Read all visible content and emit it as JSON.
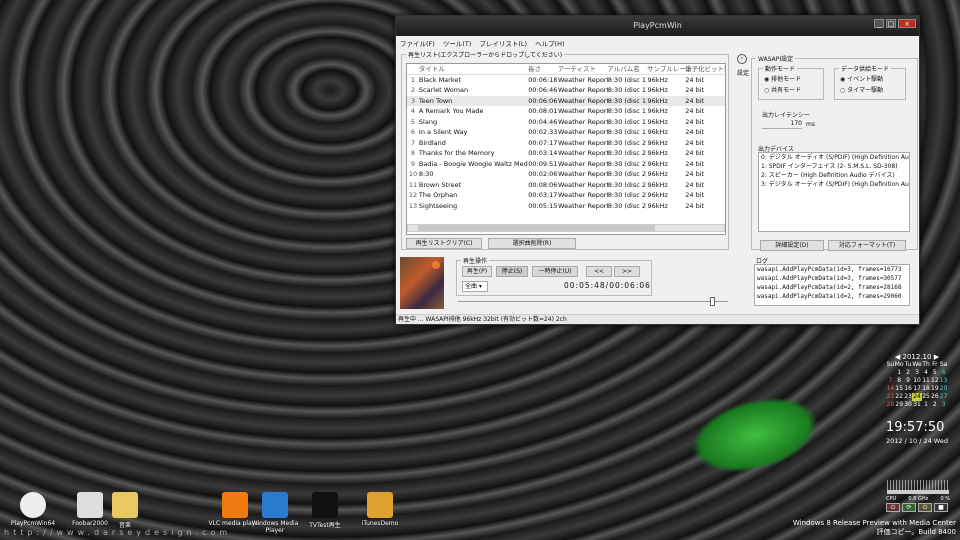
{
  "window": {
    "title": "PlayPcmWin"
  },
  "menu": [
    "ファイル(F)",
    "ツール(T)",
    "プレイリスト(L)",
    "ヘルプ(H)"
  ],
  "playlist": {
    "legend": "再生リスト(エクスプローラーからドロップしてください)",
    "headers": [
      "",
      "タイトル",
      "長さ",
      "アーティスト",
      "アルバム名",
      "サンプルレート",
      "量子化ビット数"
    ],
    "rows": [
      [
        "1",
        "Black Market",
        "00:06:18",
        "Weather Report",
        "8:30 (disc 1)",
        "96kHz",
        "24 bit"
      ],
      [
        "2",
        "Scarlet Woman",
        "00:06:46",
        "Weather Report",
        "8:30 (disc 1)",
        "96kHz",
        "24 bit"
      ],
      [
        "3",
        "Teen Town",
        "00:06:06",
        "Weather Report",
        "8:30 (disc 1)",
        "96kHz",
        "24 bit"
      ],
      [
        "4",
        "A Remark You Made",
        "00:08:01",
        "Weather Report",
        "8:30 (disc 1)",
        "96kHz",
        "24 bit"
      ],
      [
        "5",
        "Slang",
        "00:04:46",
        "Weather Report",
        "8:30 (disc 1)",
        "96kHz",
        "24 bit"
      ],
      [
        "6",
        "In a Silent Way",
        "00:02:33",
        "Weather Report",
        "8:30 (disc 1)",
        "96kHz",
        "24 bit"
      ],
      [
        "7",
        "Birdland",
        "00:07:17",
        "Weather Report",
        "8:30 (disc 2)",
        "96kHz",
        "24 bit"
      ],
      [
        "8",
        "Thanks for the Memory",
        "00:03:14",
        "Weather Report",
        "8:30 (disc 2)",
        "96kHz",
        "24 bit"
      ],
      [
        "9",
        "Badia - Boogie Woogie Waltz Medley",
        "00:09:51",
        "Weather Report",
        "8:30 (disc 2)",
        "96kHz",
        "24 bit"
      ],
      [
        "10",
        "8:30",
        "00:02:06",
        "Weather Report",
        "8:30 (disc 2)",
        "96kHz",
        "24 bit"
      ],
      [
        "11",
        "Brown Street",
        "00:08:06",
        "Weather Report",
        "8:30 (disc 2)",
        "96kHz",
        "24 bit"
      ],
      [
        "12",
        "The Orphan",
        "00:03:17",
        "Weather Report",
        "8:30 (disc 2)",
        "96kHz",
        "24 bit"
      ],
      [
        "13",
        "Sightseeing",
        "00:05:15",
        "Weather Report",
        "8:30 (disc 2)",
        "96kHz",
        "24 bit"
      ]
    ],
    "selected_row": 3,
    "clear_button": "再生リストクリア(C)",
    "delete_button": "選択曲削除(R)"
  },
  "playback": {
    "legend": "再生操作",
    "play": "再生(P)",
    "stop": "停止(S)",
    "pause": "一時停止(U)",
    "prev": "<<",
    "next": ">>",
    "mode": "全曲",
    "time": "00:05:48/00:06:06",
    "progress": 0.95
  },
  "status": "再生中 ... WASAPI排他 96kHz 32bit (有効ビット数=24) 2ch",
  "settings": {
    "toggle": "設定",
    "wasapi_legend": "WASAPI設定",
    "share_legend": "動作モード",
    "share_opts": [
      "排他モード",
      "共有モード"
    ],
    "share_selected": 0,
    "data_legend": "データ供給モード",
    "data_opts": [
      "イベント駆動",
      "タイマー駆動"
    ],
    "data_selected": 0,
    "latency_legend": "出力レイテンシー",
    "latency_value": "170",
    "latency_unit": "ms",
    "device_legend": "出力デバイス",
    "devices": [
      "0: デジタル オーディオ (S/PDIF) (High Definition Audio",
      "1: SPDIF インターフェイス (2- S.M.S.L. SD-308)",
      "2: スピーカー (High Definition Audio デバイス)",
      "3: デジタル オーディオ (S/PDIF) (High Definition Audio"
    ],
    "detail_button": "詳細設定(D)",
    "test_button": "対応フォーマット(T)",
    "log_legend": "ログ",
    "log": [
      "wasapi.AddPlayPcmData(id=3, frames=16773",
      "wasapi.AddPlayPcmData(id=3, frames=30577",
      "wasapi.AddPlayPcmData(id=2, frames=28168",
      "wasapi.AddPlayPcmData(id=2, frames=29060"
    ]
  },
  "desktop_icons": [
    "PlayPcmWin64",
    "Foobar2000",
    "音楽",
    "VLC media player",
    "Windows Media Player",
    "TVTest再生",
    "iTunesDemo"
  ],
  "watermark": "http://www.darseydesign.com",
  "calendar": {
    "month": "2012.10",
    "days_header": [
      "Su",
      "Mo",
      "Tu",
      "We",
      "Th",
      "Fr",
      "Sa"
    ],
    "cells": [
      "",
      "1",
      "2",
      "3",
      "4",
      "5",
      "6",
      "7",
      "8",
      "9",
      "10",
      "11",
      "12",
      "13",
      "14",
      "15",
      "16",
      "17",
      "18",
      "19",
      "20",
      "21",
      "22",
      "23",
      "24",
      "25",
      "26",
      "27",
      "28",
      "29",
      "30",
      "31",
      "1",
      "2",
      "3"
    ],
    "today": "24"
  },
  "clock": {
    "time": "19:57:50",
    "date": "2012 / 10 / 24 Wed"
  },
  "meter": {
    "labels": [
      "CPU",
      "0.8 GHz",
      "0 %"
    ]
  },
  "os_text": [
    "Windows 8 Release Preview with Media Center",
    "評価コピー。Build 8400"
  ]
}
